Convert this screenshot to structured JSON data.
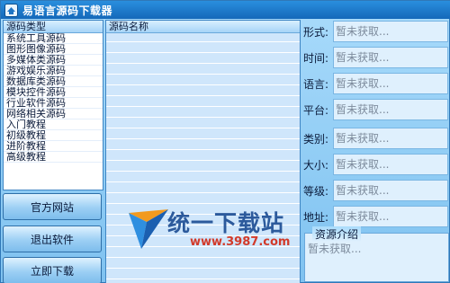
{
  "window": {
    "title": "易语言源码下载器"
  },
  "left_panel": {
    "header": "源码类型",
    "items": [
      "系统工具源码",
      "图形图像源码",
      "多媒体类源码",
      "游戏娱乐源码",
      "数据库类源码",
      "模块控件源码",
      "行业软件源码",
      "网络相关源码",
      "入门教程",
      "初级教程",
      "进阶教程",
      "高级教程"
    ]
  },
  "buttons": {
    "official_site": "官方网站",
    "exit": "退出软件",
    "download": "立即下载"
  },
  "middle_panel": {
    "header": "源码名称"
  },
  "watermark": {
    "text": "统一下载站",
    "url": "www.3987.com"
  },
  "details": {
    "fields": [
      {
        "label": "形式:",
        "value": "暂未获取..."
      },
      {
        "label": "时间:",
        "value": "暂未获取..."
      },
      {
        "label": "语言:",
        "value": "暂未获取..."
      },
      {
        "label": "平台:",
        "value": "暂未获取..."
      },
      {
        "label": "类别:",
        "value": "暂未获取..."
      },
      {
        "label": "大小:",
        "value": "暂未获取..."
      },
      {
        "label": "等级:",
        "value": "暂未获取..."
      },
      {
        "label": "地址:",
        "value": "暂未获取..."
      }
    ],
    "intro_title": "资源介绍",
    "intro_text": "暂未获取..."
  },
  "colors": {
    "title_bar": "#1a78c9",
    "background": "#8ec9f2",
    "placeholder_text": "#7d8b9c"
  }
}
